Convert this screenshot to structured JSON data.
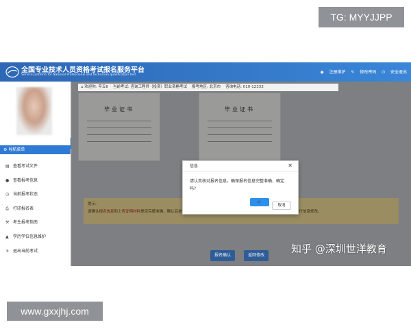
{
  "watermarks": {
    "tg": "TG: MYYJJPP",
    "url": "www.gxxjhj.com",
    "zhihu": "知乎 @深圳世洋教育"
  },
  "header": {
    "title_cn": "全国专业技术人员资格考试报名服务平台",
    "title_en": "Service platform for National Professional and technician qualification test",
    "links": [
      {
        "icon": "user-icon",
        "label": "注册维护"
      },
      {
        "icon": "edit-icon",
        "label": "修改密码"
      },
      {
        "icon": "power-icon",
        "label": "安全退出"
      }
    ]
  },
  "info_bar": {
    "welcome_label": "欢迎你:",
    "welcome_name": "辛五6",
    "exam_label": "当前考试:",
    "exam_value": "咨询工程师（投资）职业资格考试",
    "region_label": "报考地区:",
    "region_value": "北京市",
    "phone_label": "咨询电话:",
    "phone_value": "010-12333"
  },
  "sidebar": {
    "nav_head": "导航菜单",
    "items": [
      {
        "icon": "file-icon",
        "label": "查看考试文件"
      },
      {
        "icon": "info-icon",
        "label": "查看报考信息"
      },
      {
        "icon": "clock-icon",
        "label": "当前报考状态"
      },
      {
        "icon": "print-icon",
        "label": "打印报名表"
      },
      {
        "icon": "wrench-icon",
        "label": "考生报考指南"
      },
      {
        "icon": "graduation-icon",
        "label": "学历学位信息维护"
      },
      {
        "icon": "exit-icon",
        "label": "退出当前考试"
      }
    ]
  },
  "certificates": [
    {
      "title": "毕业证书"
    },
    {
      "title": "毕业证书"
    }
  ],
  "hint": {
    "label": "提示:",
    "text_pre": "请确认",
    "red1": "报名信息",
    "mid": "和",
    "red2": "上传证明材料",
    "text_post": "是否完整准确，确认后单击“报名确认”按钮，进入后续审核等环节。否则单击“返回修改”按钮进行信息修改。"
  },
  "buttons": {
    "confirm": "报名确认",
    "back": "返回修改"
  },
  "dialog": {
    "title": "信息",
    "message": "请认真核对报名信息，确保报名信息完整准确，确定吗?",
    "ok": "",
    "cancel": "取消"
  }
}
